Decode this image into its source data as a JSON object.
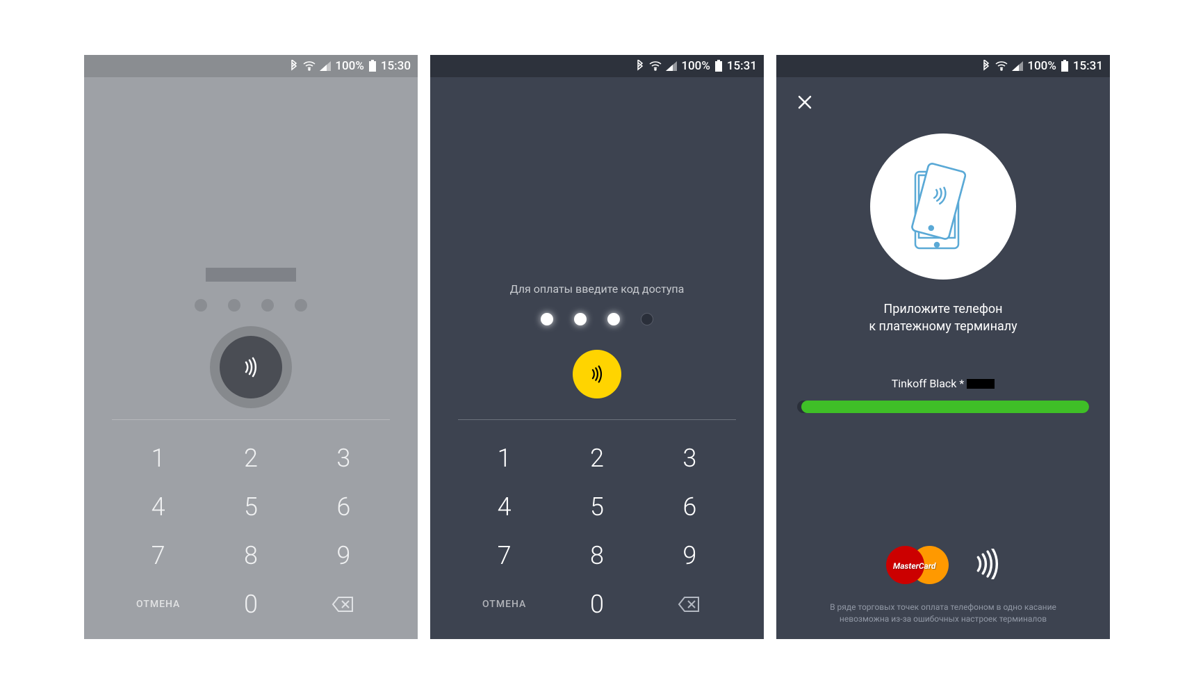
{
  "statusbar": {
    "battery": "100%",
    "t1": "15:30",
    "t2": "15:31",
    "t3": "15:31"
  },
  "screen1": {
    "cancel": "ОТМЕНА",
    "keys": [
      "1",
      "2",
      "3",
      "4",
      "5",
      "6",
      "7",
      "8",
      "9",
      "",
      "0",
      ""
    ]
  },
  "screen2": {
    "prompt": "Для оплаты введите код доступа",
    "cancel": "ОТМЕНА",
    "pin_entered": 3,
    "keys": [
      "1",
      "2",
      "3",
      "4",
      "5",
      "6",
      "7",
      "8",
      "9",
      "",
      "0",
      ""
    ]
  },
  "screen3": {
    "line1": "Приложите телефон",
    "line2": "к платежному терминалу",
    "card_name": "Tinkoff Black *",
    "mastercard": "MasterCard",
    "footer1": "В ряде торговых точек оплата телефоном в одно касание",
    "footer2": "невозможна из-за ошибочных настроек терминалов"
  }
}
